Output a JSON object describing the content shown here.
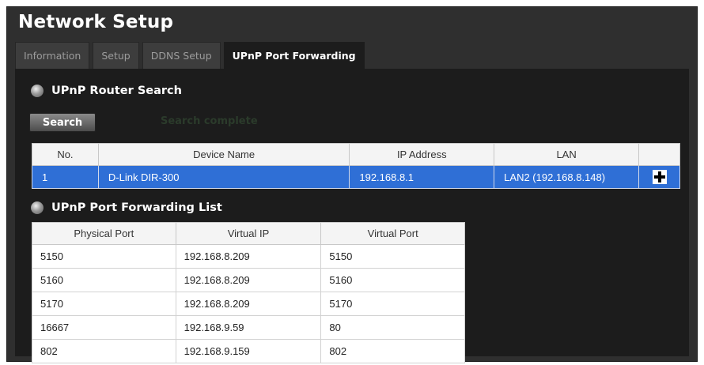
{
  "page": {
    "title": "Network Setup"
  },
  "tabs": [
    {
      "label": "Information"
    },
    {
      "label": "Setup"
    },
    {
      "label": "DDNS Setup"
    },
    {
      "label": "UPnP Port Forwarding"
    }
  ],
  "router_search": {
    "heading": "UPnP Router Search",
    "search_label": "Search",
    "status": "Search complete",
    "columns": [
      "No.",
      "Device Name",
      "IP Address",
      "LAN"
    ],
    "rows": [
      {
        "no": "1",
        "device": "D-Link DIR-300",
        "ip": "192.168.8.1",
        "lan": "LAN2 (192.168.8.148)"
      }
    ]
  },
  "port_forwarding": {
    "heading": "UPnP Port Forwarding List",
    "columns": [
      "Physical Port",
      "Virtual IP",
      "Virtual Port"
    ],
    "rows": [
      {
        "physical": "5150",
        "vip": "192.168.8.209",
        "vport": "5150"
      },
      {
        "physical": "5160",
        "vip": "192.168.8.209",
        "vport": "5160"
      },
      {
        "physical": "5170",
        "vip": "192.168.8.209",
        "vport": "5170"
      },
      {
        "physical": "16667",
        "vip": "192.168.9.59",
        "vport": "80"
      },
      {
        "physical": "802",
        "vip": "192.168.9.159",
        "vport": "802"
      }
    ]
  },
  "colors": {
    "panel_bg": "#2f2f2f",
    "content_bg": "#1c1c1c",
    "selected_row": "#2f6fd6",
    "status_text": "#2b3b2b"
  },
  "icons": {
    "section_bullet": "bullet-icon",
    "add_device": "add-icon"
  }
}
